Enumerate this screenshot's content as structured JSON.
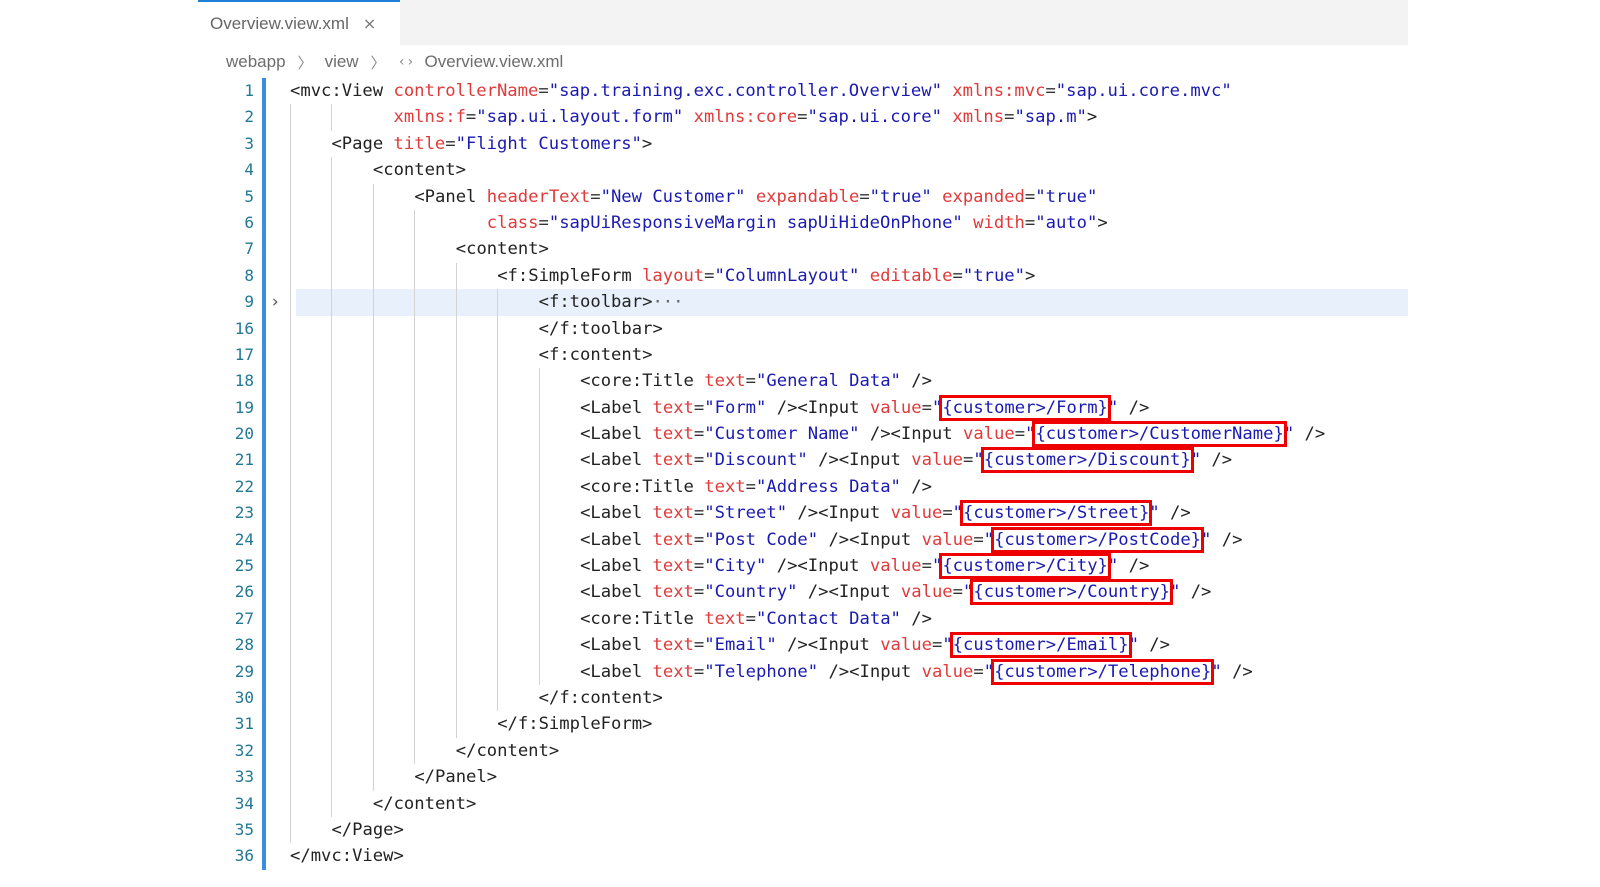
{
  "tab": {
    "label": "Overview.view.xml",
    "close": "×"
  },
  "breadcrumb": {
    "items": [
      "webapp",
      "view",
      "Overview.view.xml"
    ],
    "file_icon": "‹›"
  },
  "colors": {
    "accent": "#1e7fd6",
    "highlight_box": "#ee0000",
    "attribute": "#e03a3a",
    "value": "#1a1ab0"
  },
  "lines": [
    {
      "n": "1",
      "indent": 0,
      "tokens": [
        [
          "t",
          "<mvc:View "
        ],
        [
          "a",
          "controllerName"
        ],
        [
          "e",
          "="
        ],
        [
          "v",
          "\"sap.training.exc.controller.Overview\""
        ],
        [
          "t",
          " "
        ],
        [
          "a",
          "xmlns:mvc"
        ],
        [
          "e",
          "="
        ],
        [
          "v",
          "\"sap.ui.core.mvc\""
        ]
      ]
    },
    {
      "n": "2",
      "indent": 0,
      "guides": [
        1,
        2
      ],
      "pad": "          ",
      "tokens": [
        [
          "a",
          "xmlns:f"
        ],
        [
          "e",
          "="
        ],
        [
          "v",
          "\"sap.ui.layout.form\""
        ],
        [
          "t",
          " "
        ],
        [
          "a",
          "xmlns:core"
        ],
        [
          "e",
          "="
        ],
        [
          "v",
          "\"sap.ui.core\""
        ],
        [
          "t",
          " "
        ],
        [
          "a",
          "xmlns"
        ],
        [
          "e",
          "="
        ],
        [
          "v",
          "\"sap.m\""
        ],
        [
          "t",
          ">"
        ]
      ]
    },
    {
      "n": "3",
      "indent": 1,
      "tokens": [
        [
          "t",
          "<Page "
        ],
        [
          "a",
          "title"
        ],
        [
          "e",
          "="
        ],
        [
          "v",
          "\"Flight Customers\""
        ],
        [
          "t",
          ">"
        ]
      ]
    },
    {
      "n": "4",
      "indent": 2,
      "tokens": [
        [
          "t",
          "<content>"
        ]
      ]
    },
    {
      "n": "5",
      "indent": 3,
      "tokens": [
        [
          "t",
          "<Panel "
        ],
        [
          "a",
          "headerText"
        ],
        [
          "e",
          "="
        ],
        [
          "v",
          "\"New Customer\""
        ],
        [
          "t",
          " "
        ],
        [
          "a",
          "expandable"
        ],
        [
          "e",
          "="
        ],
        [
          "v",
          "\"true\""
        ],
        [
          "t",
          " "
        ],
        [
          "a",
          "expanded"
        ],
        [
          "e",
          "="
        ],
        [
          "v",
          "\"true\""
        ]
      ]
    },
    {
      "n": "6",
      "indent": 3,
      "guides": [
        4
      ],
      "pad": "       ",
      "tokens": [
        [
          "a",
          "class"
        ],
        [
          "e",
          "="
        ],
        [
          "v",
          "\"sapUiResponsiveMargin sapUiHideOnPhone\""
        ],
        [
          "t",
          " "
        ],
        [
          "a",
          "width"
        ],
        [
          "e",
          "="
        ],
        [
          "v",
          "\"auto\""
        ],
        [
          "t",
          ">"
        ]
      ]
    },
    {
      "n": "7",
      "indent": 4,
      "tokens": [
        [
          "t",
          "<content>"
        ]
      ]
    },
    {
      "n": "8",
      "indent": 5,
      "tokens": [
        [
          "t",
          "<f:SimpleForm "
        ],
        [
          "a",
          "layout"
        ],
        [
          "e",
          "="
        ],
        [
          "v",
          "\"ColumnLayout\""
        ],
        [
          "t",
          " "
        ],
        [
          "a",
          "editable"
        ],
        [
          "e",
          "="
        ],
        [
          "v",
          "\"true\""
        ],
        [
          "t",
          ">"
        ]
      ]
    },
    {
      "n": "9",
      "indent": 6,
      "fold": "›",
      "highlight": true,
      "tokens": [
        [
          "t",
          "<f:toolbar>"
        ],
        [
          "fe",
          "···"
        ]
      ]
    },
    {
      "n": "16",
      "indent": 6,
      "tokens": [
        [
          "t",
          "</f:toolbar>"
        ]
      ]
    },
    {
      "n": "17",
      "indent": 6,
      "tokens": [
        [
          "t",
          "<f:content>"
        ]
      ]
    },
    {
      "n": "18",
      "indent": 7,
      "tokens": [
        [
          "t",
          "<core:Title "
        ],
        [
          "a",
          "text"
        ],
        [
          "e",
          "="
        ],
        [
          "v",
          "\"General Data\""
        ],
        [
          "t",
          " />"
        ]
      ]
    },
    {
      "n": "19",
      "indent": 7,
      "tokens": [
        [
          "t",
          "<Label "
        ],
        [
          "a",
          "text"
        ],
        [
          "e",
          "="
        ],
        [
          "v",
          "\"Form\""
        ],
        [
          "t",
          " /><Input "
        ],
        [
          "a",
          "value"
        ],
        [
          "e",
          "="
        ],
        [
          "v",
          "\""
        ],
        [
          "bx",
          "{customer>/Form}"
        ],
        [
          "v",
          "\""
        ],
        [
          "t",
          " />"
        ]
      ]
    },
    {
      "n": "20",
      "indent": 7,
      "tokens": [
        [
          "t",
          "<Label "
        ],
        [
          "a",
          "text"
        ],
        [
          "e",
          "="
        ],
        [
          "v",
          "\"Customer Name\""
        ],
        [
          "t",
          " /><Input "
        ],
        [
          "a",
          "value"
        ],
        [
          "e",
          "="
        ],
        [
          "v",
          "\""
        ],
        [
          "bx",
          "{customer>/CustomerName}"
        ],
        [
          "v",
          "\""
        ],
        [
          "t",
          " />"
        ]
      ]
    },
    {
      "n": "21",
      "indent": 7,
      "tokens": [
        [
          "t",
          "<Label "
        ],
        [
          "a",
          "text"
        ],
        [
          "e",
          "="
        ],
        [
          "v",
          "\"Discount\""
        ],
        [
          "t",
          " /><Input "
        ],
        [
          "a",
          "value"
        ],
        [
          "e",
          "="
        ],
        [
          "v",
          "\""
        ],
        [
          "bx",
          "{customer>/Discount}"
        ],
        [
          "v",
          "\""
        ],
        [
          "t",
          " />"
        ]
      ]
    },
    {
      "n": "22",
      "indent": 7,
      "tokens": [
        [
          "t",
          "<core:Title "
        ],
        [
          "a",
          "text"
        ],
        [
          "e",
          "="
        ],
        [
          "v",
          "\"Address Data\""
        ],
        [
          "t",
          " />"
        ]
      ]
    },
    {
      "n": "23",
      "indent": 7,
      "tokens": [
        [
          "t",
          "<Label "
        ],
        [
          "a",
          "text"
        ],
        [
          "e",
          "="
        ],
        [
          "v",
          "\"Street\""
        ],
        [
          "t",
          " /><Input "
        ],
        [
          "a",
          "value"
        ],
        [
          "e",
          "="
        ],
        [
          "v",
          "\""
        ],
        [
          "bx",
          "{customer>/Street}"
        ],
        [
          "v",
          "\""
        ],
        [
          "t",
          " />"
        ]
      ]
    },
    {
      "n": "24",
      "indent": 7,
      "tokens": [
        [
          "t",
          "<Label "
        ],
        [
          "a",
          "text"
        ],
        [
          "e",
          "="
        ],
        [
          "v",
          "\"Post Code\""
        ],
        [
          "t",
          " /><Input "
        ],
        [
          "a",
          "value"
        ],
        [
          "e",
          "="
        ],
        [
          "v",
          "\""
        ],
        [
          "bx",
          "{customer>/PostCode}"
        ],
        [
          "v",
          "\""
        ],
        [
          "t",
          " />"
        ]
      ]
    },
    {
      "n": "25",
      "indent": 7,
      "tokens": [
        [
          "t",
          "<Label "
        ],
        [
          "a",
          "text"
        ],
        [
          "e",
          "="
        ],
        [
          "v",
          "\"City\""
        ],
        [
          "t",
          " /><Input "
        ],
        [
          "a",
          "value"
        ],
        [
          "e",
          "="
        ],
        [
          "v",
          "\""
        ],
        [
          "bx",
          "{customer>/City}"
        ],
        [
          "v",
          "\""
        ],
        [
          "t",
          " />"
        ]
      ]
    },
    {
      "n": "26",
      "indent": 7,
      "tokens": [
        [
          "t",
          "<Label "
        ],
        [
          "a",
          "text"
        ],
        [
          "e",
          "="
        ],
        [
          "v",
          "\"Country\""
        ],
        [
          "t",
          " /><Input "
        ],
        [
          "a",
          "value"
        ],
        [
          "e",
          "="
        ],
        [
          "v",
          "\""
        ],
        [
          "bx",
          "{customer>/Country}"
        ],
        [
          "v",
          "\""
        ],
        [
          "t",
          " />"
        ]
      ]
    },
    {
      "n": "27",
      "indent": 7,
      "tokens": [
        [
          "t",
          "<core:Title "
        ],
        [
          "a",
          "text"
        ],
        [
          "e",
          "="
        ],
        [
          "v",
          "\"Contact Data\""
        ],
        [
          "t",
          " />"
        ]
      ]
    },
    {
      "n": "28",
      "indent": 7,
      "tokens": [
        [
          "t",
          "<Label "
        ],
        [
          "a",
          "text"
        ],
        [
          "e",
          "="
        ],
        [
          "v",
          "\"Email\""
        ],
        [
          "t",
          " /><Input "
        ],
        [
          "a",
          "value"
        ],
        [
          "e",
          "="
        ],
        [
          "v",
          "\""
        ],
        [
          "bx",
          "{customer>/Email}"
        ],
        [
          "v",
          "\""
        ],
        [
          "t",
          " />"
        ]
      ]
    },
    {
      "n": "29",
      "indent": 7,
      "tokens": [
        [
          "t",
          "<Label "
        ],
        [
          "a",
          "text"
        ],
        [
          "e",
          "="
        ],
        [
          "v",
          "\"Telephone\""
        ],
        [
          "t",
          " /><Input "
        ],
        [
          "a",
          "value"
        ],
        [
          "e",
          "="
        ],
        [
          "v",
          "\""
        ],
        [
          "bx",
          "{customer>/Telephone}"
        ],
        [
          "v",
          "\""
        ],
        [
          "t",
          " />"
        ]
      ]
    },
    {
      "n": "30",
      "indent": 6,
      "tokens": [
        [
          "t",
          "</f:content>"
        ]
      ]
    },
    {
      "n": "31",
      "indent": 5,
      "tokens": [
        [
          "t",
          "</f:SimpleForm>"
        ]
      ]
    },
    {
      "n": "32",
      "indent": 4,
      "tokens": [
        [
          "t",
          "</content>"
        ]
      ]
    },
    {
      "n": "33",
      "indent": 3,
      "tokens": [
        [
          "t",
          "</Panel>"
        ]
      ]
    },
    {
      "n": "34",
      "indent": 2,
      "tokens": [
        [
          "t",
          "</content>"
        ]
      ]
    },
    {
      "n": "35",
      "indent": 1,
      "tokens": [
        [
          "t",
          "</Page>"
        ]
      ]
    },
    {
      "n": "36",
      "indent": 0,
      "tokens": [
        [
          "t",
          "</mvc:View>"
        ]
      ]
    }
  ]
}
